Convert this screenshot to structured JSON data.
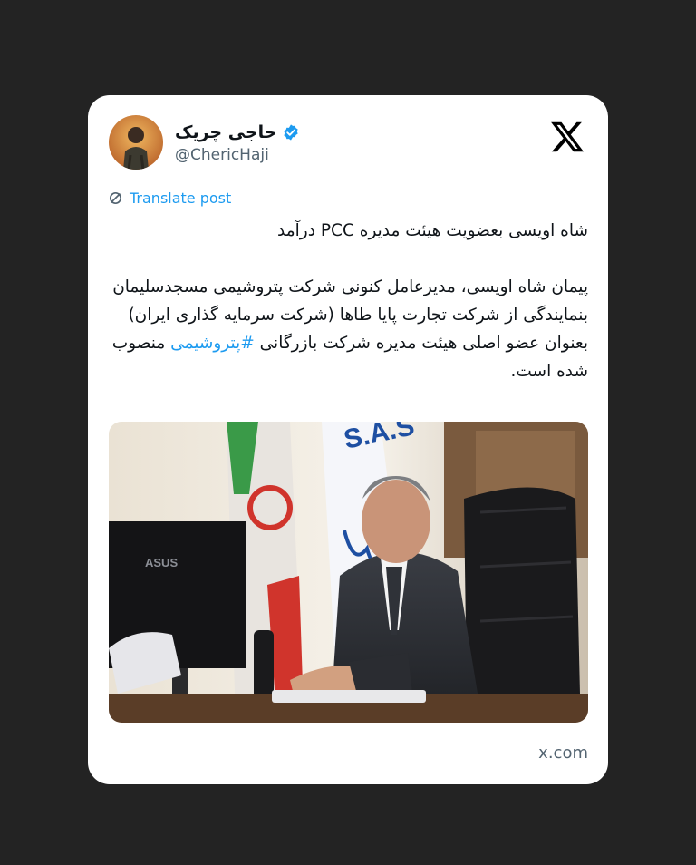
{
  "post": {
    "author_name": "حاجی چریک",
    "handle": "@ChericHaji",
    "translate_label": "Translate post",
    "headline": "شاه اویسی بعضویت هیئت مدیره PCC درآمد",
    "body_text": "پیمان شاه اویسی، مدیرعامل کنونی شرکت پتروشیمی مسجدسلیمان بنمایندگی از شرکت تجارت پایا طاها (شرکت سرمایه گذاری ایران) بعنوان عضو اصلی هیئت مدیره شرکت بازرگانی",
    "hashtag": "#پتروشیمی",
    "body_end": "منصوب شده است.",
    "monitor_brand": "ASUS",
    "banner_text": "S.A.S",
    "source": "x.com"
  },
  "colors": {
    "background": "#232323",
    "card": "#ffffff",
    "link": "#1d9bf0",
    "text": "#0f1419",
    "muted": "#536471"
  },
  "icons": {
    "verified": "verified-badge-icon",
    "logo": "x-logo-icon",
    "translate": "translate-icon"
  }
}
